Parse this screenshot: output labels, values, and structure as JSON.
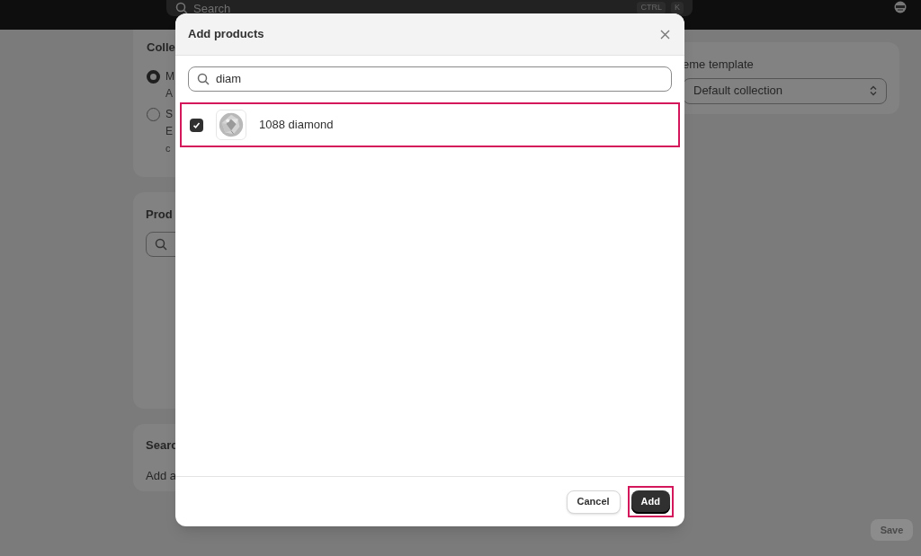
{
  "top_bar": {
    "search": {
      "placeholder": "Search"
    },
    "shortcut": [
      "CTRL",
      "K"
    ]
  },
  "page": {
    "collection_type": {
      "title": "Colle",
      "options": [
        {
          "label": "M",
          "description": [
            "A"
          ],
          "selected": true
        },
        {
          "label": "S",
          "description": [
            "E",
            "c"
          ],
          "selected": false
        }
      ]
    },
    "products": {
      "title": "Prod"
    },
    "search_listing": {
      "title": "Searc",
      "text": "Add a"
    },
    "theme_template": {
      "label": "eme template",
      "value": "Default collection"
    },
    "save_button": {
      "label": "Save",
      "disabled": true
    }
  },
  "dialog": {
    "title": "Add products",
    "search": {
      "value": "diam"
    },
    "results": [
      {
        "name": "1088 diamond",
        "checked": true,
        "highlighted": true
      }
    ],
    "buttons": [
      {
        "label": "Cancel",
        "kind": "secondary",
        "highlighted": false
      },
      {
        "label": "Add",
        "kind": "primary",
        "highlighted": true
      }
    ]
  }
}
